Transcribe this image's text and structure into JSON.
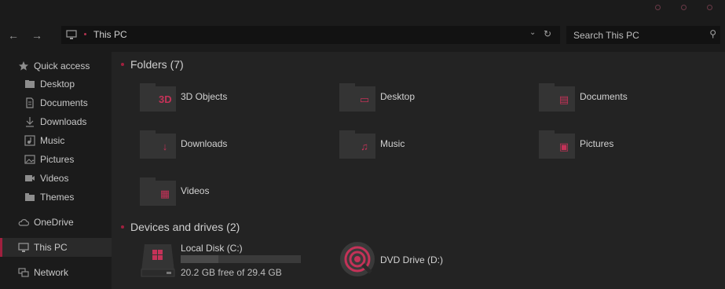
{
  "navbar": {
    "path": "This PC",
    "search_placeholder": "Search This PC"
  },
  "sidebar": {
    "quick_access": "Quick access",
    "items": [
      {
        "label": "Desktop",
        "icon": "desktop-folder-icon"
      },
      {
        "label": "Documents",
        "icon": "documents-icon"
      },
      {
        "label": "Downloads",
        "icon": "downloads-icon"
      },
      {
        "label": "Music",
        "icon": "music-icon"
      },
      {
        "label": "Pictures",
        "icon": "pictures-icon"
      },
      {
        "label": "Videos",
        "icon": "videos-icon"
      },
      {
        "label": "Themes",
        "icon": "folder-icon"
      }
    ],
    "onedrive": "OneDrive",
    "this_pc": "This PC",
    "network": "Network"
  },
  "main": {
    "folders_title": "Folders (7)",
    "folders": [
      {
        "label": "3D Objects",
        "icon": "3d-objects-icon",
        "glyph": "3D"
      },
      {
        "label": "Desktop",
        "icon": "desktop-icon",
        "glyph": "▭"
      },
      {
        "label": "Documents",
        "icon": "documents-icon",
        "glyph": "▤"
      },
      {
        "label": "Downloads",
        "icon": "download-arrow-icon",
        "glyph": "↓"
      },
      {
        "label": "Music",
        "icon": "music-note-icon",
        "glyph": "♫"
      },
      {
        "label": "Pictures",
        "icon": "picture-icon",
        "glyph": "▣"
      },
      {
        "label": "Videos",
        "icon": "film-icon",
        "glyph": "▦"
      }
    ],
    "devices_title": "Devices and drives (2)",
    "local_disk": {
      "label": "Local Disk (C:)",
      "free": "20.2 GB free of 29.4 GB",
      "used_fraction": 0.313
    },
    "dvd": {
      "label": "DVD Drive (D:)"
    }
  },
  "colors": {
    "accent": "#c43258",
    "background": "#1b1b1b",
    "content": "#232323"
  }
}
